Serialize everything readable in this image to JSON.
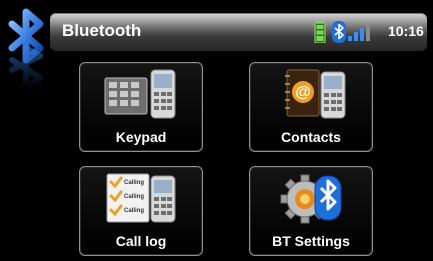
{
  "header": {
    "title": "Bluetooth",
    "time": "10:16"
  },
  "status_icons": [
    "battery-icon",
    "bluetooth-icon",
    "signal-strength-icon"
  ],
  "tiles": [
    {
      "label": "Keypad",
      "icon": "keypad-phone-icon"
    },
    {
      "label": "Contacts",
      "icon": "address-book-icon"
    },
    {
      "label": "Call log",
      "icon": "call-log-checklist-icon"
    },
    {
      "label": "BT Settings",
      "icon": "bluetooth-gear-icon"
    }
  ],
  "call_log_icon_text": "Calling",
  "colors": {
    "background": "#000000",
    "accent_blue": "#1e6fd9",
    "battery_green": "#5fbf3a",
    "tile_border": "#8f8f8f"
  }
}
